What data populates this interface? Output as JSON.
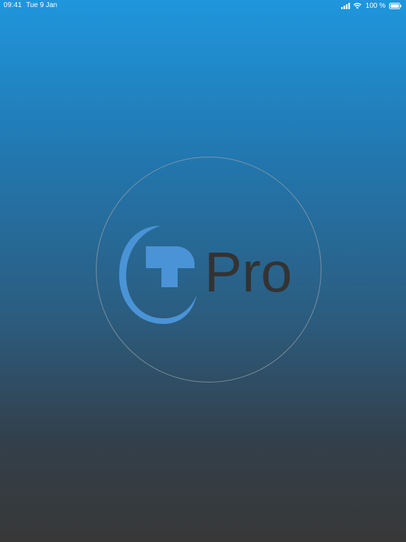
{
  "status_bar": {
    "time": "09:41",
    "date": "Tue 9 Jan",
    "battery_percent": "100 %",
    "icons": [
      "signal-icon",
      "wifi-icon",
      "battery-icon"
    ]
  },
  "splash": {
    "logo_text": "Pro",
    "logo_icon": "t-swoosh-logo-icon"
  },
  "colors": {
    "gradient_top": "#1f96dd",
    "gradient_bottom": "#383838",
    "logo_blue": "#4a93d6",
    "logo_text": "#333333",
    "ring": "#969fa8"
  }
}
